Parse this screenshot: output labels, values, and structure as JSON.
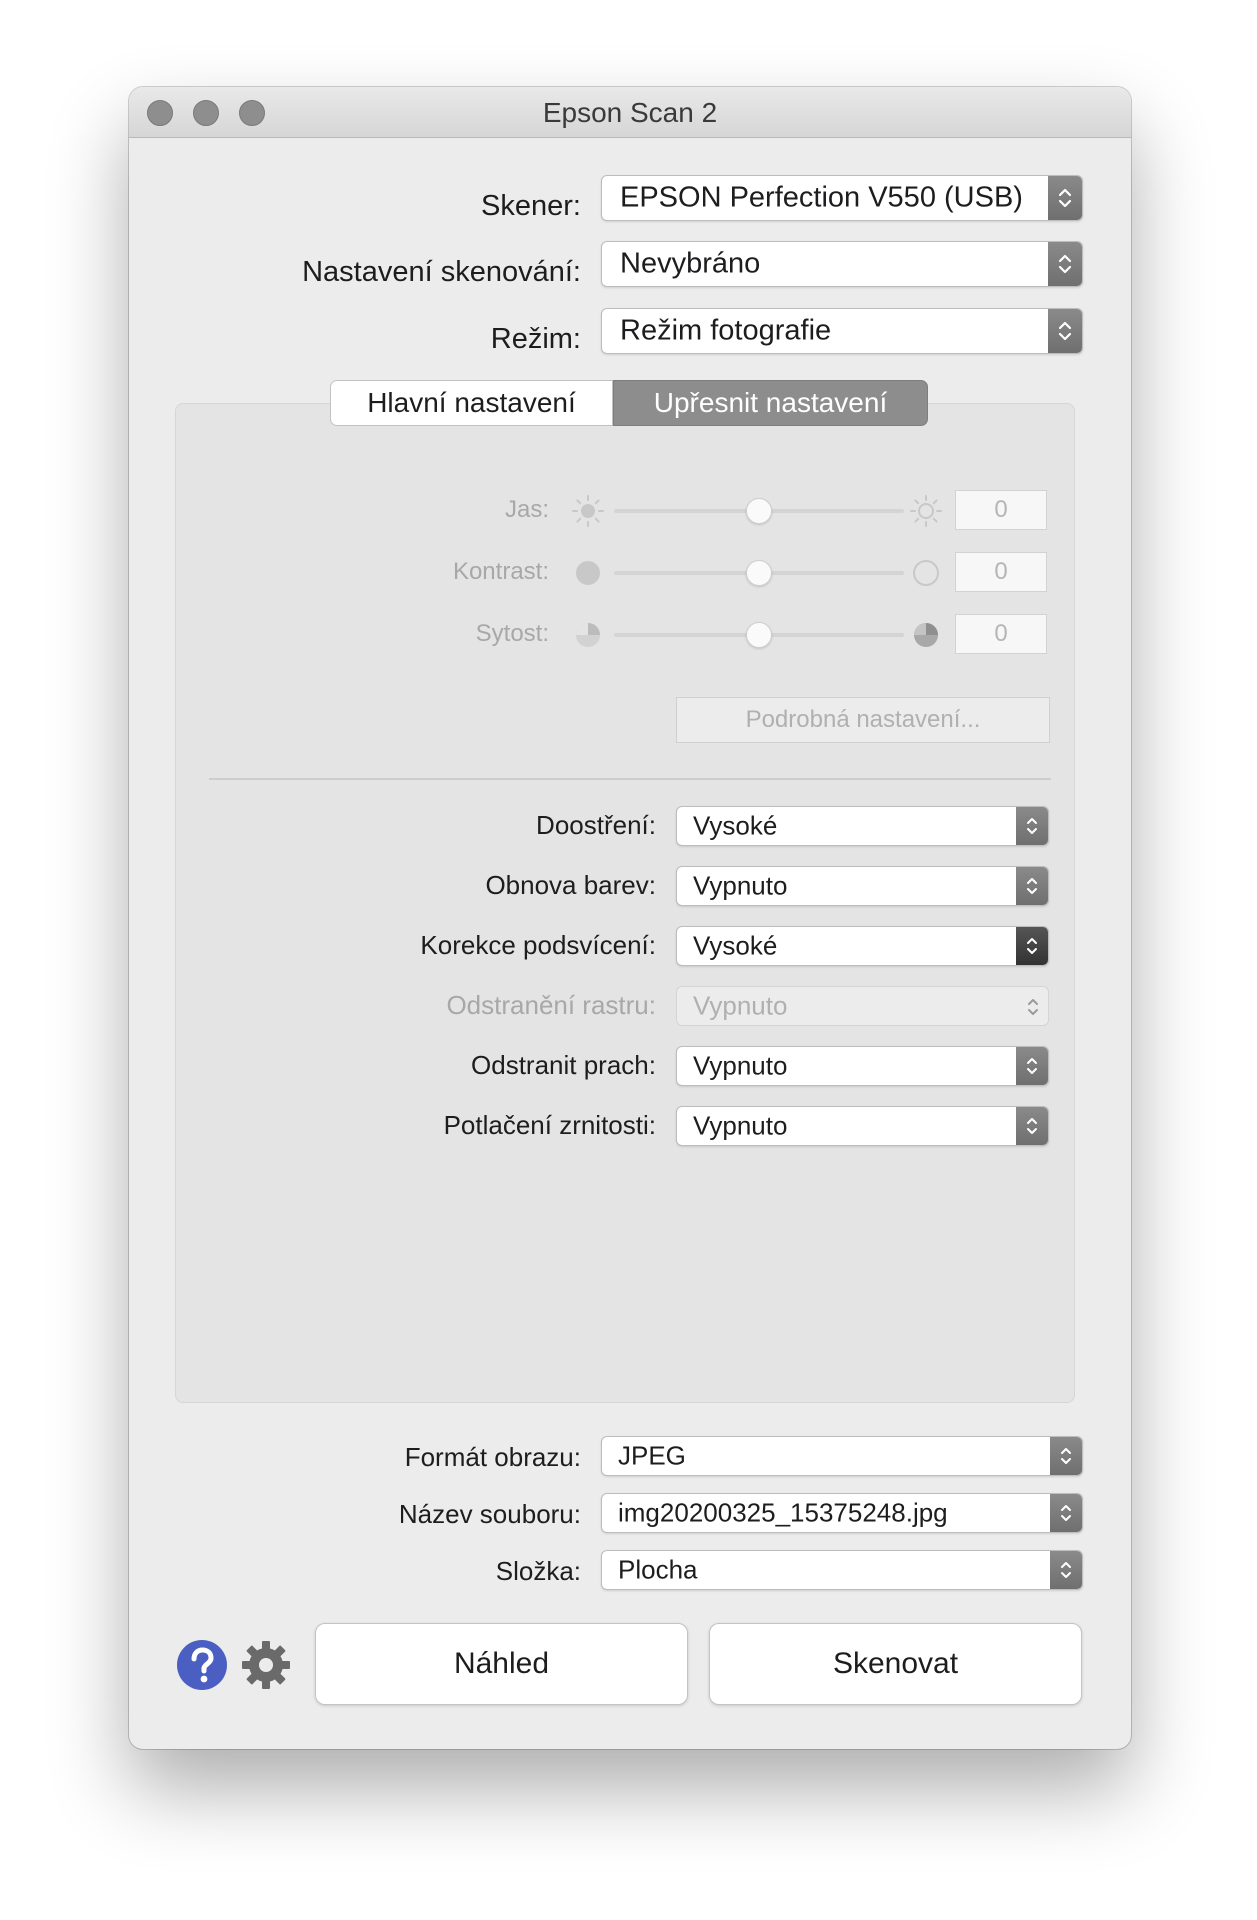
{
  "window": {
    "title": "Epson Scan 2"
  },
  "top": {
    "scanner_label": "Skener:",
    "scanner_value": "EPSON Perfection V550 (USB)",
    "scan_settings_label": "Nastavení skenování:",
    "scan_settings_value": "Nevybráno",
    "mode_label": "Režim:",
    "mode_value": "Režim fotografie"
  },
  "tabs": [
    {
      "label": "Hlavní nastavení",
      "selected": false
    },
    {
      "label": "Upřesnit nastavení",
      "selected": true
    }
  ],
  "adjustments": {
    "brightness_label": "Jas:",
    "brightness_value": "0",
    "contrast_label": "Kontrast:",
    "contrast_value": "0",
    "saturation_label": "Sytost:",
    "saturation_value": "0",
    "slider_position": 0.5,
    "detail_button": "Podrobná nastavení..."
  },
  "options": {
    "sharpening_label": "Doostření:",
    "sharpening_value": "Vysoké",
    "color_restore_label": "Obnova barev:",
    "color_restore_value": "Vypnuto",
    "backlight_label": "Korekce podsvícení:",
    "backlight_value": "Vysoké",
    "descreen_label": "Odstranění rastru:",
    "descreen_value": "Vypnuto",
    "dust_label": "Odstranit prach:",
    "dust_value": "Vypnuto",
    "grain_label": "Potlačení zrnitosti:",
    "grain_value": "Vypnuto"
  },
  "output": {
    "format_label": "Formát obrazu:",
    "format_value": "JPEG",
    "filename_label": "Název souboru:",
    "filename_value": "img20200325_15375248.jpg",
    "folder_label": "Složka:",
    "folder_value": "Plocha"
  },
  "buttons": {
    "preview": "Náhled",
    "scan": "Skenovat"
  },
  "colors": {
    "accent_blue": "#4a5fc1",
    "chevron_gray": "#7a7a7a",
    "tab_selected": "#8d8d8d"
  },
  "icons": {
    "help": "help-icon",
    "settings": "gear-icon"
  }
}
